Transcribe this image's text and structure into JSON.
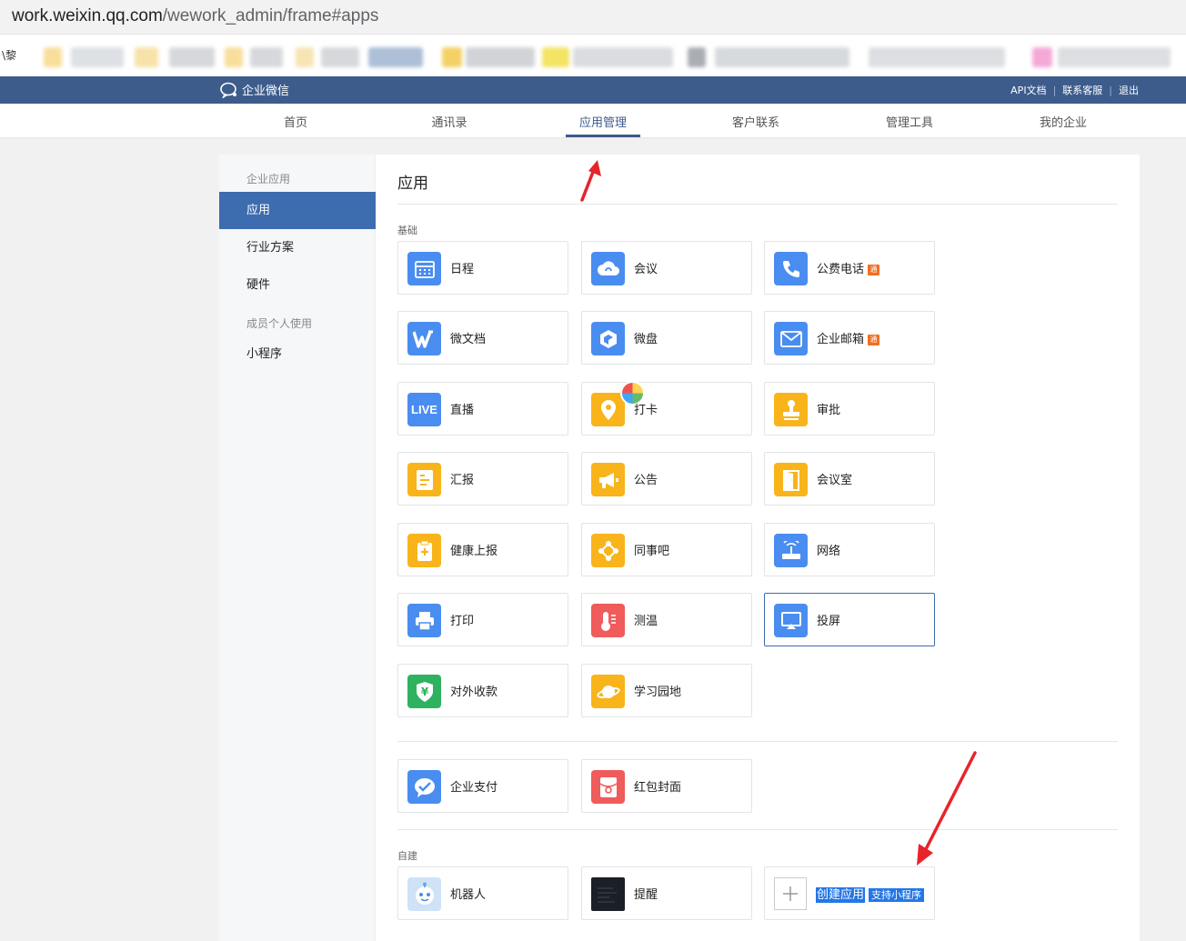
{
  "browser": {
    "url_host": "work.weixin.qq.com",
    "url_path": "/wework_admin/frame#apps",
    "bookmark_first": "\\黎"
  },
  "header": {
    "logo_text": "企业微信",
    "links": [
      "API文档",
      "联系客服",
      "退出"
    ]
  },
  "nav": {
    "items": [
      "首页",
      "通讯录",
      "应用管理",
      "客户联系",
      "管理工具",
      "我的企业"
    ],
    "active_index": 2
  },
  "sidebar": {
    "section1": "企业应用",
    "items1": [
      "应用",
      "行业方案",
      "硬件"
    ],
    "section2": "成员个人使用",
    "items2": [
      "小程序"
    ]
  },
  "main": {
    "title": "应用",
    "group_basic": "基础",
    "group_custom": "自建",
    "apps": [
      {
        "label": "日程",
        "icon": "calendar-icon",
        "color": "#4a8df0"
      },
      {
        "label": "会议",
        "icon": "cloud-meeting-icon",
        "color": "#4a8df0"
      },
      {
        "label": "公费电话",
        "icon": "phone-icon",
        "color": "#4a8df0",
        "tag": "通"
      },
      {
        "label": "微文档",
        "icon": "w-doc-icon",
        "color": "#4a8df0"
      },
      {
        "label": "微盘",
        "icon": "cube-drive-icon",
        "color": "#4a8df0"
      },
      {
        "label": "企业邮箱",
        "icon": "mail-icon",
        "color": "#4a8df0",
        "tag": "通"
      },
      {
        "label": "直播",
        "icon": "live-icon",
        "color": "#4a8df0",
        "icon_text": "LIVE"
      },
      {
        "label": "打卡",
        "icon": "location-pin-icon",
        "color": "#f8b41a"
      },
      {
        "label": "审批",
        "icon": "stamp-icon",
        "color": "#f8b41a"
      },
      {
        "label": "汇报",
        "icon": "report-icon",
        "color": "#f8b41a"
      },
      {
        "label": "公告",
        "icon": "megaphone-icon",
        "color": "#f8b41a"
      },
      {
        "label": "会议室",
        "icon": "door-icon",
        "color": "#f8b41a"
      },
      {
        "label": "健康上报",
        "icon": "clipboard-plus-icon",
        "color": "#f8b41a"
      },
      {
        "label": "同事吧",
        "icon": "nodes-icon",
        "color": "#f8b41a"
      },
      {
        "label": "网络",
        "icon": "router-icon",
        "color": "#4a8df0"
      },
      {
        "label": "打印",
        "icon": "printer-icon",
        "color": "#4a8df0"
      },
      {
        "label": "测温",
        "icon": "thermometer-icon",
        "color": "#f05b5b"
      },
      {
        "label": "投屏",
        "icon": "screen-cast-icon",
        "color": "#4a8df0",
        "selected": true
      },
      {
        "label": "对外收款",
        "icon": "yuan-shield-icon",
        "color": "#2fb25f"
      },
      {
        "label": "学习园地",
        "icon": "planet-icon",
        "color": "#f8b41a"
      }
    ],
    "apps2": [
      {
        "label": "企业支付",
        "icon": "pay-bubble-icon",
        "color": "#4a8df0"
      },
      {
        "label": "红包封面",
        "icon": "red-envelope-icon",
        "color": "#f05b5b"
      }
    ],
    "custom": [
      {
        "label": "机器人",
        "icon": "robot-icon",
        "color": "#cfe2f6"
      },
      {
        "label": "提醒",
        "icon": "reminder-icon",
        "color": "#1a2026"
      }
    ],
    "create": {
      "label": "创建应用",
      "badge": "支持小程序"
    }
  }
}
